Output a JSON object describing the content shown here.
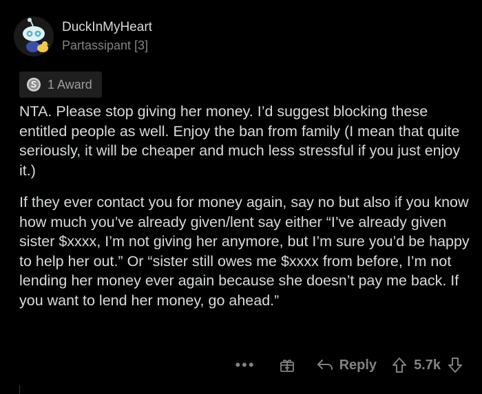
{
  "comment": {
    "username": "DuckInMyHeart",
    "flair": "Partassipant [3]",
    "award_label": "1 Award",
    "paragraphs": [
      "NTA. Please stop giving her money. I’d suggest blocking these entitled people as well. Enjoy the ban from family (I mean that quite seriously, it will be cheaper and much less stressful if you just enjoy it.)",
      "If they ever contact you for money again, say no but also if you know how much you’ve already given/lent say either “I’ve already given sister $xxxx, I’m not giving her anymore, but I’m sure you’d be happy to help her out.” Or “sister still owes me $xxxx from before, I’m not lending her money ever again because she doesn’t pay me back. If you want to lend her money, go ahead.”"
    ]
  },
  "actions": {
    "more": "•••",
    "reply_label": "Reply",
    "score": "5.7k"
  },
  "icons": {
    "avatar": "snoo-avatar",
    "award": "silver-award-icon",
    "gift": "gift-icon",
    "reply": "reply-arrow-icon",
    "upvote": "upvote-arrow-icon",
    "downvote": "downvote-arrow-icon"
  },
  "colors": {
    "background": "#000000",
    "text": "#d7dadc",
    "muted": "#818384",
    "chip": "#1f1f1f"
  }
}
